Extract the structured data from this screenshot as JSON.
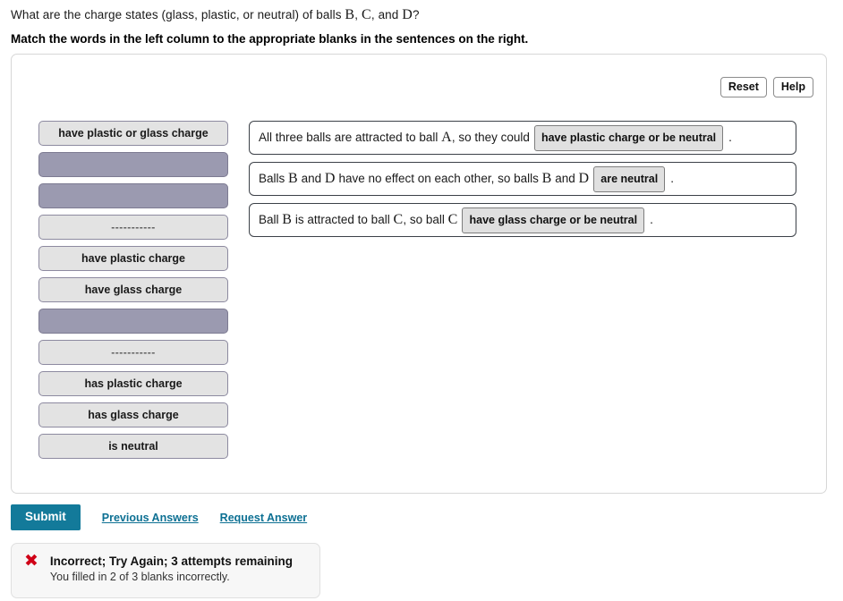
{
  "header": {
    "question": {
      "pre": "What are the charge states (glass, plastic, or neutral) of balls ",
      "var1": "B",
      "sep1": ", ",
      "var2": "C",
      "sep2": ", and ",
      "var3": "D",
      "post": "?"
    },
    "instruction": "Match the words in the left column to the appropriate blanks in the sentences on the right."
  },
  "toolbar": {
    "reset_label": "Reset",
    "help_label": "Help"
  },
  "word_bank": {
    "tiles": [
      {
        "label": "have plastic or glass charge",
        "state": "available"
      },
      {
        "label": "",
        "state": "used"
      },
      {
        "label": "",
        "state": "used"
      },
      {
        "label": "-----------",
        "state": "dashes"
      },
      {
        "label": "have plastic charge",
        "state": "available"
      },
      {
        "label": "have glass charge",
        "state": "available"
      },
      {
        "label": "",
        "state": "used"
      },
      {
        "label": "-----------",
        "state": "dashes"
      },
      {
        "label": "has plastic charge",
        "state": "available"
      },
      {
        "label": "has glass charge",
        "state": "available"
      },
      {
        "label": "is neutral",
        "state": "available"
      }
    ]
  },
  "sentences": [
    {
      "pre_a": "All three balls are attracted to ball ",
      "var_a": "A",
      "pre_b": ", so they could",
      "blank": "have plastic charge or be neutral",
      "tail": "."
    },
    {
      "pre_a": "Balls ",
      "var_a": "B",
      "pre_b": " and ",
      "var_b": "D",
      "pre_c": " have no effect on each other, so balls ",
      "var_c": "B",
      "pre_d": " and ",
      "var_d": "D",
      "blank": "are neutral",
      "tail": "."
    },
    {
      "pre_a": "Ball ",
      "var_a": "B",
      "pre_b": " is attracted to ball ",
      "var_b": "C",
      "pre_c": ", so ball ",
      "var_c": "C",
      "blank": "have glass charge or be neutral",
      "tail": "."
    }
  ],
  "actions": {
    "submit_label": "Submit",
    "previous_answers_label": "Previous Answers",
    "request_answer_label": "Request Answer"
  },
  "feedback": {
    "icon": "x-mark-icon",
    "glyph": "✖",
    "title": "Incorrect; Try Again; 3 attempts remaining",
    "detail": "You filled in 2 of 3 blanks incorrectly."
  },
  "colors": {
    "submit_bg": "#137a9a",
    "link": "#0d7093",
    "tile_used": "#9b9ab0",
    "tile_available": "#e3e3e3",
    "error": "#d00017"
  }
}
